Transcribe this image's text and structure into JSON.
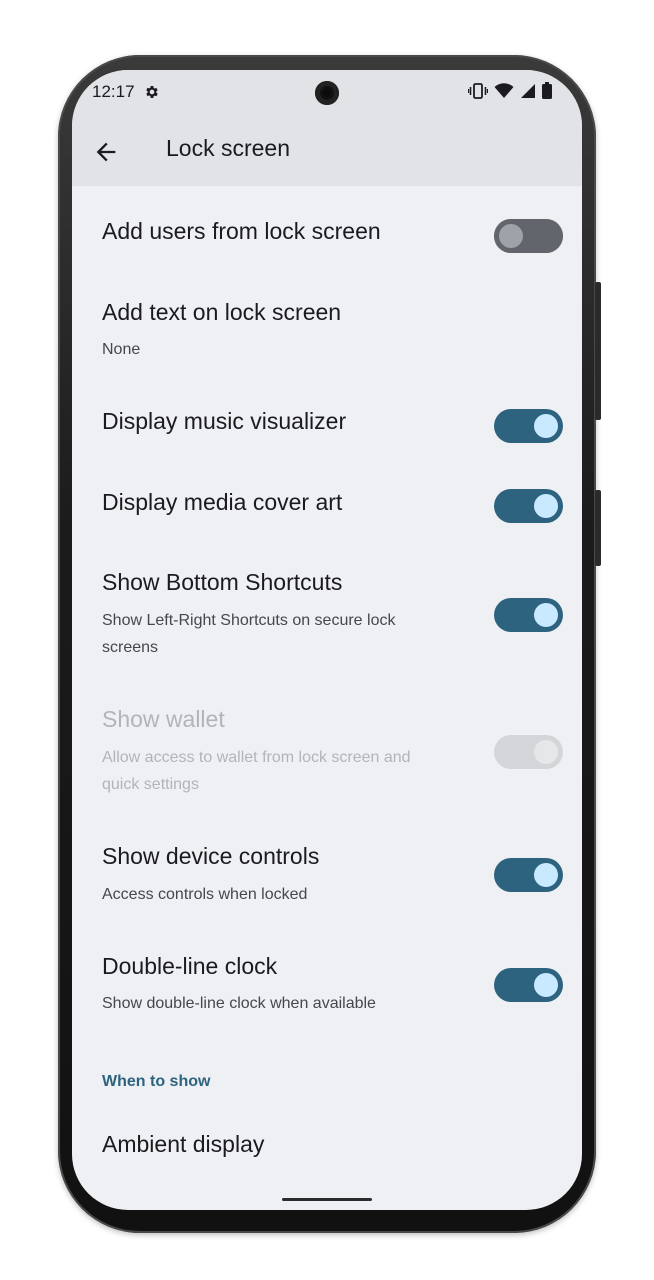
{
  "status_bar": {
    "time": "12:17",
    "icons": [
      "gear-icon",
      "vibrate-icon",
      "wifi-icon",
      "signal-icon",
      "battery-icon"
    ]
  },
  "app_bar": {
    "back_icon": "arrow-back-icon",
    "title": "Lock screen"
  },
  "settings": [
    {
      "id": "add-users",
      "title": "Add users from lock screen",
      "subtitle": "",
      "toggle": "off",
      "enabled": true
    },
    {
      "id": "add-text",
      "title": "Add text on lock screen",
      "subtitle": "None",
      "toggle": null,
      "enabled": true
    },
    {
      "id": "music-visualizer",
      "title": "Display music visualizer",
      "subtitle": "",
      "toggle": "on",
      "enabled": true
    },
    {
      "id": "media-cover",
      "title": "Display media cover art",
      "subtitle": "",
      "toggle": "on",
      "enabled": true
    },
    {
      "id": "bottom-shortcuts",
      "title": "Show Bottom Shortcuts",
      "subtitle": "Show Left-Right Shortcuts on secure lock screens",
      "toggle": "on",
      "enabled": true
    },
    {
      "id": "wallet",
      "title": "Show wallet",
      "subtitle": "Allow access to wallet from lock screen and quick settings",
      "toggle": "on",
      "enabled": false
    },
    {
      "id": "device-controls",
      "title": "Show device controls",
      "subtitle": "Access controls when locked",
      "toggle": "on",
      "enabled": true
    },
    {
      "id": "double-line-clock",
      "title": "Double-line clock",
      "subtitle": "Show double-line clock when available",
      "toggle": "on",
      "enabled": true
    }
  ],
  "section_when_to_show": {
    "header": "When to show",
    "items": [
      {
        "id": "ambient-display",
        "title": "Ambient display"
      }
    ]
  },
  "colors": {
    "accent": "#2e6380",
    "toggle_knob_on": "#c9e9ff",
    "background": "#eff0f3",
    "app_bar": "#e2e3e6"
  }
}
